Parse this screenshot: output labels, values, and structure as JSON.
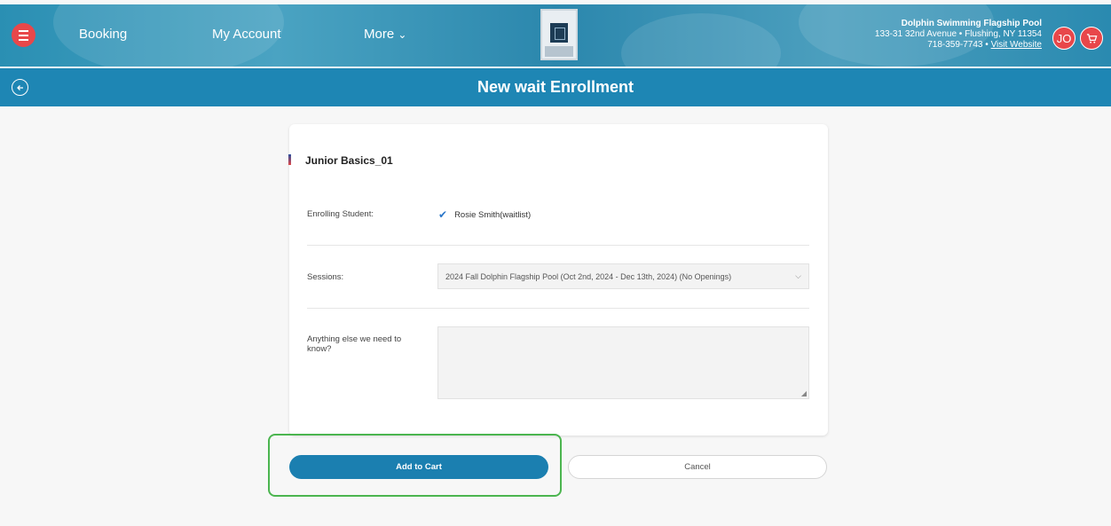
{
  "nav": {
    "booking": "Booking",
    "my_account": "My Account",
    "more": "More",
    "more_chevron": "⌄"
  },
  "pool": {
    "name": "Dolphin Swimming Flagship Pool",
    "address": "133-31 32nd Avenue • Flushing, NY 11354",
    "phone": "718-359-7743",
    "separator": " • ",
    "website": "Visit Website"
  },
  "user": {
    "initials": "JO"
  },
  "header": {
    "title": "New wait Enrollment"
  },
  "form": {
    "class_name": "Junior Basics_01",
    "enrolling_label": "Enrolling Student:",
    "student_name": "Rosie Smith(waitlist)",
    "student_checked": true,
    "sessions_label": "Sessions:",
    "session_selected": "2024 Fall Dolphin Flagship Pool (Oct 2nd, 2024 - Dec 13th, 2024) (No Openings)",
    "notes_label": "Anything else we need to know?",
    "notes_value": ""
  },
  "actions": {
    "add_to_cart": "Add to Cart",
    "cancel": "Cancel"
  },
  "colors": {
    "nav_bg": "#2a8fb3",
    "title_bar": "#1e86b4",
    "accent_red": "#e8474a",
    "primary_button": "#1b7fb0",
    "highlight_border": "#4bb54f"
  },
  "icons": {
    "menu": "hamburger-icon",
    "back": "arrow-left-icon",
    "cart": "cart-icon",
    "check": "check-icon",
    "dropdown": "chevron-down-icon"
  }
}
